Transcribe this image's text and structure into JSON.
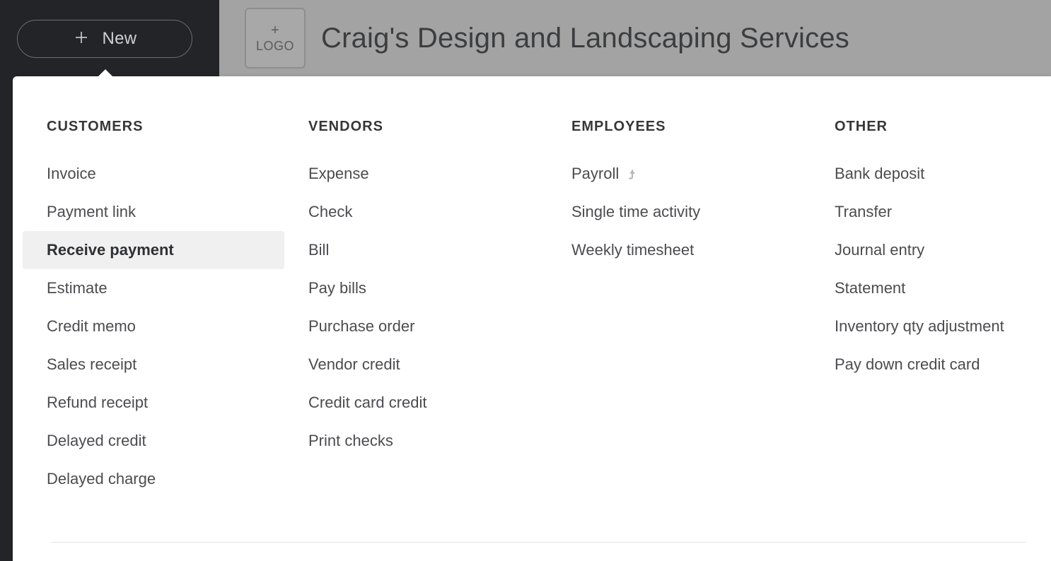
{
  "sidebar": {
    "new_label": "New"
  },
  "header": {
    "logo_text": "LOGO",
    "company_name": "Craig's Design and Landscaping Services"
  },
  "dropdown": {
    "columns": [
      {
        "heading": "CUSTOMERS",
        "items": [
          {
            "label": "Invoice"
          },
          {
            "label": "Payment link"
          },
          {
            "label": "Receive payment",
            "highlight": true
          },
          {
            "label": "Estimate"
          },
          {
            "label": "Credit memo"
          },
          {
            "label": "Sales receipt"
          },
          {
            "label": "Refund receipt"
          },
          {
            "label": "Delayed credit"
          },
          {
            "label": "Delayed charge"
          }
        ]
      },
      {
        "heading": "VENDORS",
        "items": [
          {
            "label": "Expense"
          },
          {
            "label": "Check"
          },
          {
            "label": "Bill"
          },
          {
            "label": "Pay bills"
          },
          {
            "label": "Purchase order"
          },
          {
            "label": "Vendor credit"
          },
          {
            "label": "Credit card credit"
          },
          {
            "label": "Print checks"
          }
        ]
      },
      {
        "heading": "EMPLOYEES",
        "items": [
          {
            "label": "Payroll",
            "icon": "arrow-up"
          },
          {
            "label": "Single time activity"
          },
          {
            "label": "Weekly timesheet"
          }
        ]
      },
      {
        "heading": "OTHER",
        "items": [
          {
            "label": "Bank deposit"
          },
          {
            "label": "Transfer"
          },
          {
            "label": "Journal entry"
          },
          {
            "label": "Statement"
          },
          {
            "label": "Inventory qty adjustment"
          },
          {
            "label": "Pay down credit card"
          }
        ]
      }
    ]
  }
}
